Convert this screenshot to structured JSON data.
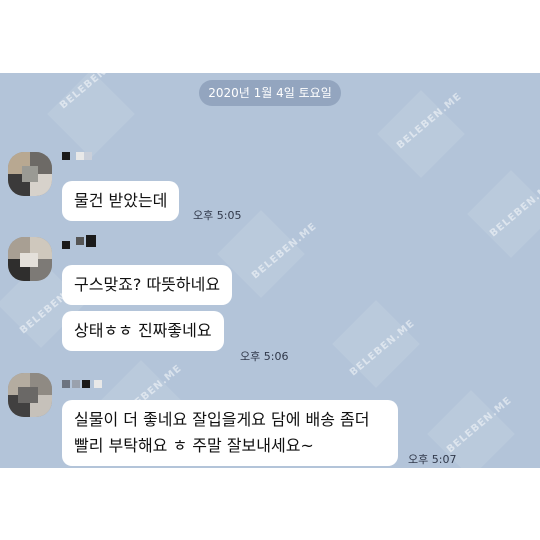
{
  "date_divider": "2020년 1월 4일 토요일",
  "watermark": "BELEBEN.ME",
  "messages": [
    {
      "text": "물건 받았는데",
      "time": "오후 5:05"
    },
    {
      "text": "구스맞죠? 따뜻하네요"
    },
    {
      "text": "상태ㅎㅎ 진짜좋네요",
      "time": "오후 5:06"
    },
    {
      "line1": "실물이 더 좋네요 잘입을게요 담에 배송 좀더",
      "line2": "빨리 부탁해요 ㅎ 주말 잘보내세요~",
      "time": "오후 5:07"
    }
  ]
}
